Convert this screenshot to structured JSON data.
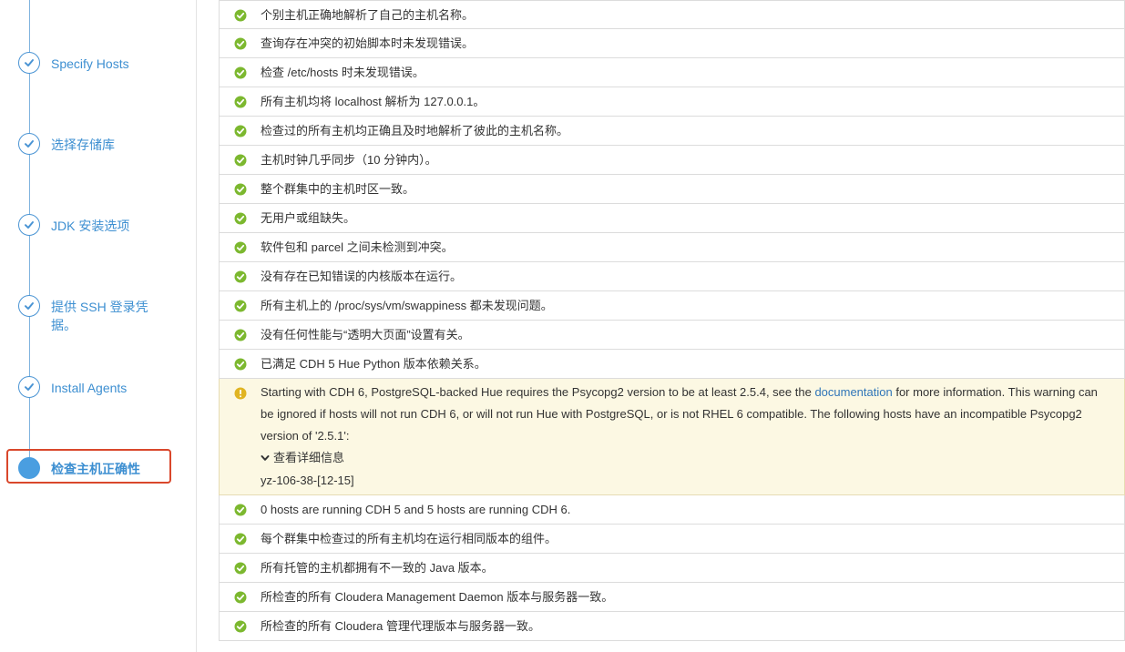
{
  "sidebar": {
    "steps": [
      {
        "label": "Specify Hosts",
        "state": "done"
      },
      {
        "label": "选择存储库",
        "state": "done"
      },
      {
        "label": "JDK 安装选项",
        "state": "done"
      },
      {
        "label": "提供 SSH 登录凭据。",
        "state": "done"
      },
      {
        "label": "Install Agents",
        "state": "done"
      },
      {
        "label": "检查主机正确性",
        "state": "current"
      }
    ]
  },
  "checks": [
    {
      "text": "个别主机正确地解析了自己的主机名称。",
      "status": "ok"
    },
    {
      "text": "查询存在冲突的初始脚本时未发现错误。",
      "status": "ok"
    },
    {
      "text": "检查 /etc/hosts 时未发现错误。",
      "status": "ok"
    },
    {
      "text": "所有主机均将 localhost 解析为 127.0.0.1。",
      "status": "ok"
    },
    {
      "text": "检查过的所有主机均正确且及时地解析了彼此的主机名称。",
      "status": "ok"
    },
    {
      "text": "主机时钟几乎同步（10 分钟内）。",
      "status": "ok"
    },
    {
      "text": "整个群集中的主机时区一致。",
      "status": "ok"
    },
    {
      "text": "无用户或组缺失。",
      "status": "ok"
    },
    {
      "text": "软件包和 parcel 之间未检测到冲突。",
      "status": "ok"
    },
    {
      "text": "没有存在已知错误的内核版本在运行。",
      "status": "ok"
    },
    {
      "text": "所有主机上的 /proc/sys/vm/swappiness 都未发现问题。",
      "status": "ok"
    },
    {
      "text": "没有任何性能与“透明大页面”设置有关。",
      "status": "ok"
    },
    {
      "text": "已满足 CDH 5 Hue Python 版本依赖关系。",
      "status": "ok"
    }
  ],
  "warning": {
    "text_before_link": "Starting with CDH 6, PostgreSQL-backed Hue requires the Psycopg2 version to be at least 2.5.4, see the ",
    "link_text": "documentation",
    "text_after_link": " for more information. This warning can be ignored if hosts will not run CDH 6, or will not run Hue with PostgreSQL, or is not RHEL 6 compatible. The following hosts have an incompatible Psycopg2 version of '2.5.1':",
    "details_toggle": "查看详细信息",
    "hosts": "yz-106-38-[12-15]",
    "status": "warning"
  },
  "checks_after": [
    {
      "text": "0 hosts are running CDH 5 and 5 hosts are running CDH 6.",
      "status": "ok"
    },
    {
      "text": "每个群集中检查过的所有主机均在运行相同版本的组件。",
      "status": "ok"
    },
    {
      "text": "所有托管的主机都拥有不一致的 Java 版本。",
      "status": "ok"
    },
    {
      "text": "所检查的所有 Cloudera Management Daemon 版本与服务器一致。",
      "status": "ok"
    },
    {
      "text": "所检查的所有 Cloudera 管理代理版本与服务器一致。",
      "status": "ok"
    }
  ],
  "colors": {
    "ok": "#7cb82f",
    "warning": "#e0b422",
    "accent": "#3d8fd1",
    "highlight_border": "#d9472b"
  }
}
